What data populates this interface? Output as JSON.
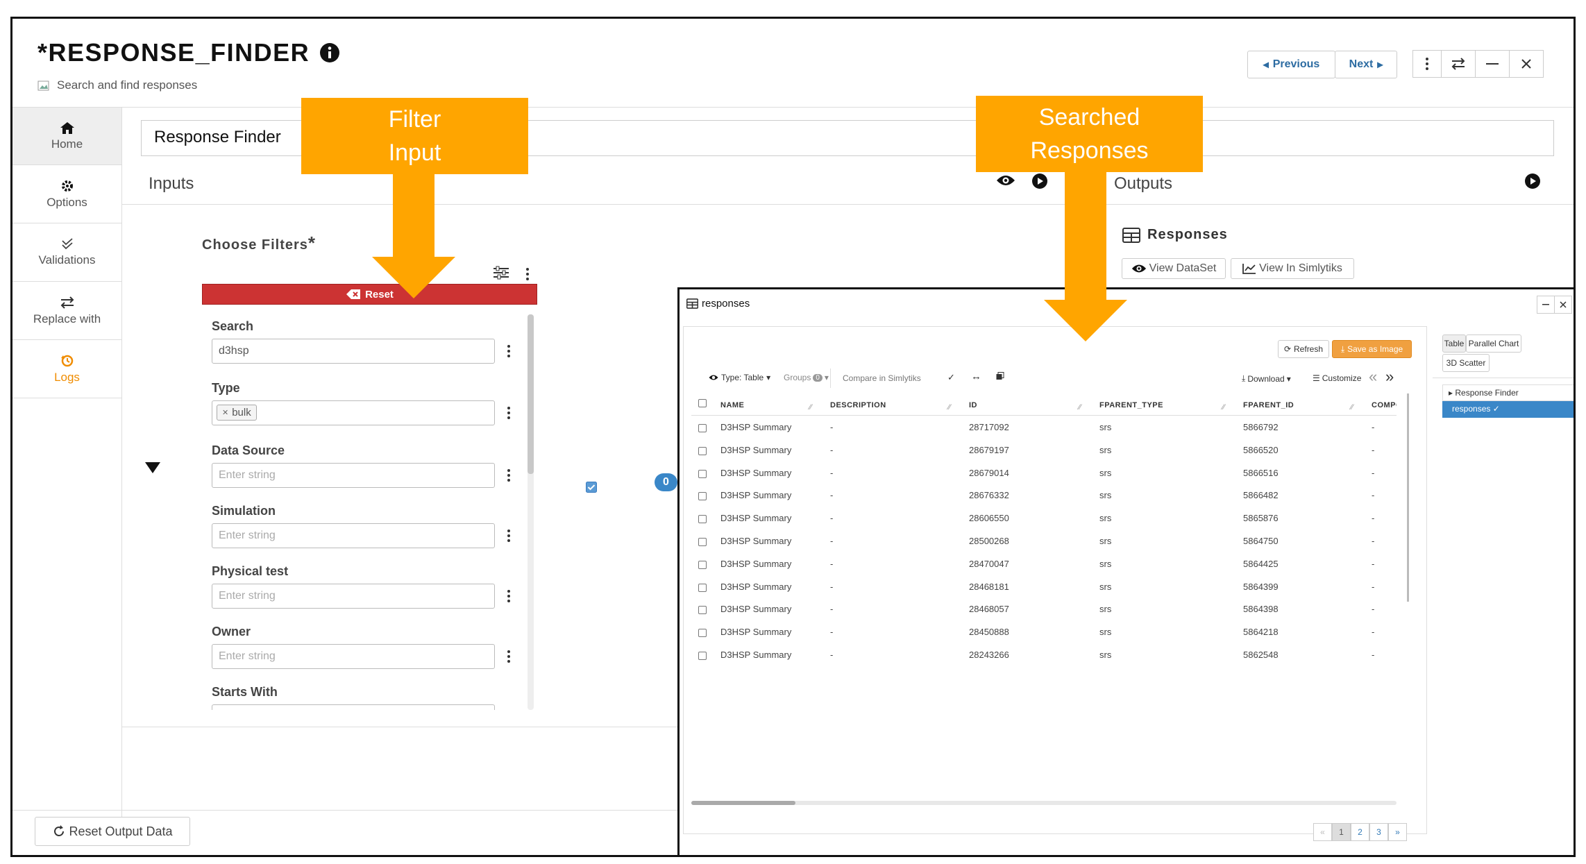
{
  "app": {
    "title": "*RESPONSE_FINDER",
    "subtitle": "Search and find responses",
    "prev_label": "Previous",
    "next_label": "Next"
  },
  "sidebar": {
    "items": [
      {
        "label": "Home",
        "icon": "home-icon"
      },
      {
        "label": "Options",
        "icon": "gear-icon"
      },
      {
        "label": "Validations",
        "icon": "double-check-icon"
      },
      {
        "label": "Replace with",
        "icon": "swap-icon"
      },
      {
        "label": "Logs",
        "icon": "history-icon"
      }
    ]
  },
  "main": {
    "rf_input_value": "Response Finder",
    "inputs_label": "Inputs",
    "outputs_label": "Outputs",
    "choose_filters": "Choose Filters",
    "required_mark": "*",
    "reset_label": "Reset",
    "filters": [
      {
        "label": "Search",
        "value": "d3hsp",
        "placeholder": ""
      },
      {
        "label": "Type",
        "tag": "bulk"
      },
      {
        "label": "Data Source",
        "placeholder": "Enter string"
      },
      {
        "label": "Simulation",
        "placeholder": "Enter string"
      },
      {
        "label": "Physical test",
        "placeholder": "Enter string"
      },
      {
        "label": "Owner",
        "placeholder": "Enter string"
      },
      {
        "label": "Starts With",
        "placeholder": ""
      }
    ],
    "badge_count": "0",
    "responses_heading": "Responses",
    "view_dataset": "View DataSet",
    "view_simlytiks": "View In Simlytiks",
    "reset_output": "Reset Output Data",
    "edge_char": "d"
  },
  "callouts": {
    "filter_input": [
      "Filter",
      "Input"
    ],
    "searched_responses": [
      "Searched",
      "Responses"
    ]
  },
  "popup": {
    "title": "responses",
    "refresh": "Refresh",
    "save_image": "Save as Image",
    "type_label": "Type: Table",
    "groups_label": "Groups",
    "groups_count": "0",
    "compare": "Compare in Simlytiks",
    "download": "Download",
    "customize": "Customize",
    "side_tabs": [
      "Table",
      "Parallel Chart",
      "3D Scatter"
    ],
    "tree": {
      "parent": "Response Finder",
      "child": "responses"
    },
    "columns": [
      "NAME",
      "DESCRIPTION",
      "ID",
      "FPARENT_TYPE",
      "FPARENT_ID",
      "COMPOSITE_E"
    ],
    "rows": [
      [
        "D3HSP Summary",
        "-",
        "28717092",
        "srs",
        "5866792",
        "-"
      ],
      [
        "D3HSP Summary",
        "-",
        "28679197",
        "srs",
        "5866520",
        "-"
      ],
      [
        "D3HSP Summary",
        "-",
        "28679014",
        "srs",
        "5866516",
        "-"
      ],
      [
        "D3HSP Summary",
        "-",
        "28676332",
        "srs",
        "5866482",
        "-"
      ],
      [
        "D3HSP Summary",
        "-",
        "28606550",
        "srs",
        "5865876",
        "-"
      ],
      [
        "D3HSP Summary",
        "-",
        "28500268",
        "srs",
        "5864750",
        "-"
      ],
      [
        "D3HSP Summary",
        "-",
        "28470047",
        "srs",
        "5864425",
        "-"
      ],
      [
        "D3HSP Summary",
        "-",
        "28468181",
        "srs",
        "5864399",
        "-"
      ],
      [
        "D3HSP Summary",
        "-",
        "28468057",
        "srs",
        "5864398",
        "-"
      ],
      [
        "D3HSP Summary",
        "-",
        "28450888",
        "srs",
        "5864218",
        "-"
      ],
      [
        "D3HSP Summary",
        "-",
        "28243266",
        "srs",
        "5862548",
        "-"
      ]
    ],
    "pagination": [
      "«",
      "1",
      "2",
      "3",
      "»"
    ],
    "current_page": "1"
  },
  "colors": {
    "accent_orange": "#ffa500",
    "reset_red": "#cc3333",
    "link_blue": "#2d6ca2",
    "selected_blue": "#3a87c8"
  }
}
